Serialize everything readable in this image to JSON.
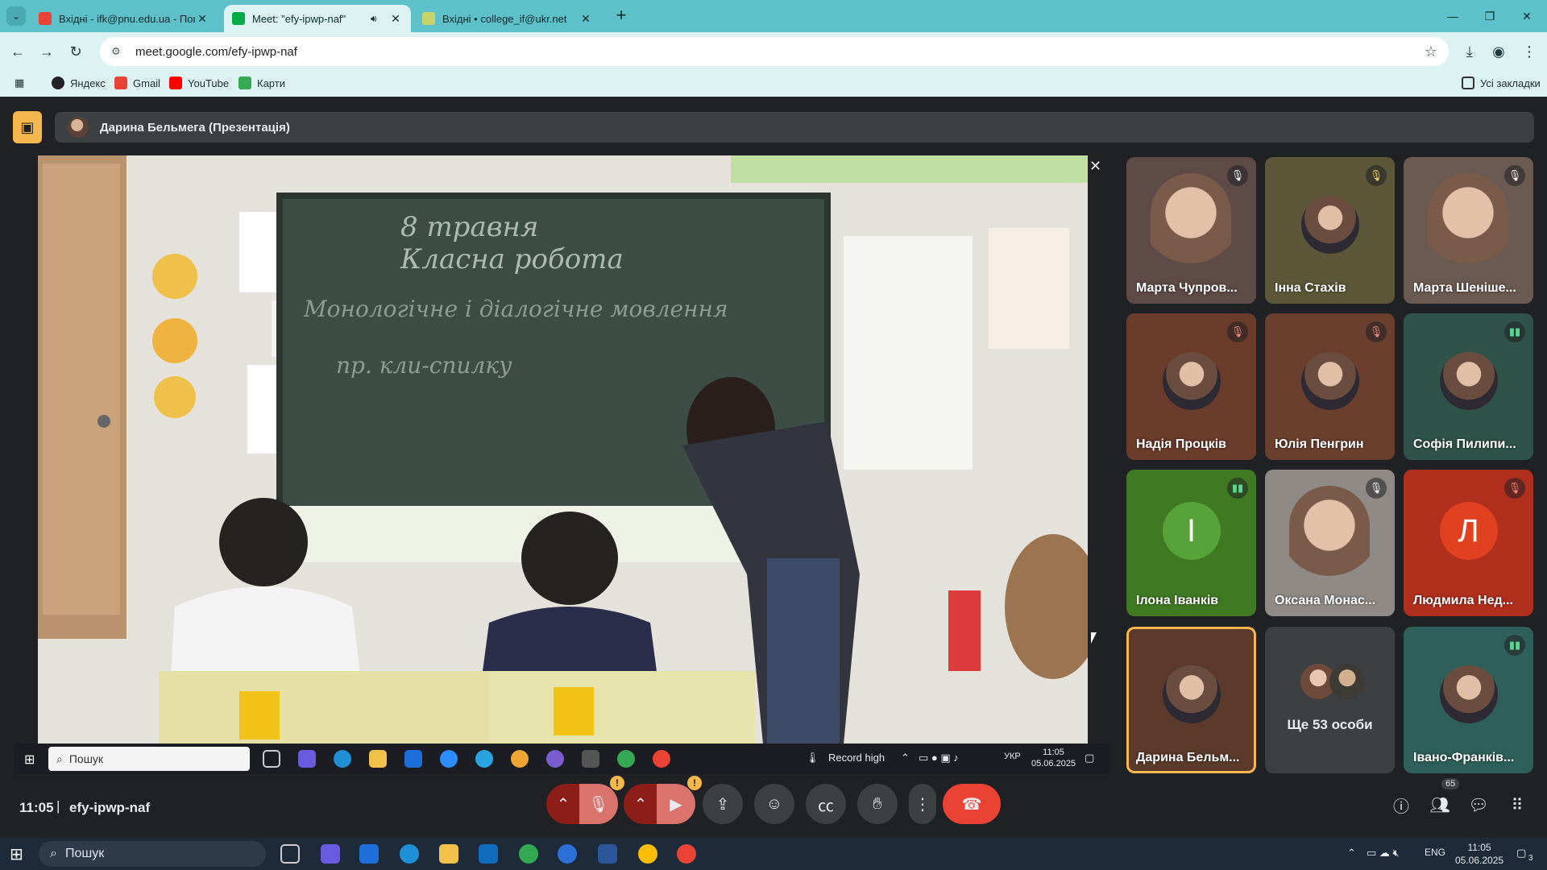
{
  "browser": {
    "tabs": [
      {
        "title": "Вхідні - ifk@pnu.edu.ua - Пош",
        "favicon_color": "#ea4335"
      },
      {
        "title": "Meet: \"efy-ipwp-naf\"",
        "favicon_color": "#00ac47"
      },
      {
        "title": "Вхідні • college_if@ukr.net",
        "favicon_color": "#c9d36b"
      }
    ],
    "url": "meet.google.com/efy-ipwp-naf",
    "bookmarks": [
      "Яндекс",
      "Gmail",
      "YouTube",
      "Карти"
    ],
    "bookmarks_all": "Усі закладки"
  },
  "meet": {
    "presenter_label": "Дарина Бельмега (Презентація)",
    "time": "11:05",
    "separator": "|",
    "code": "efy-ipwp-naf",
    "participants_count": "65",
    "more_label": "Ще 53 особи",
    "accent": "#f6b74f",
    "hangup_color": "#ea4335",
    "tiles": [
      {
        "name": "Марта Чупров...",
        "mic": "muted",
        "bg": "#5e4b47"
      },
      {
        "name": "Інна Стахів",
        "mic": "muted-yellow",
        "bg": "#5c5738"
      },
      {
        "name": "Марта Шеніше...",
        "mic": "muted",
        "bg": "#6b5a52"
      },
      {
        "name": "Надія Процків",
        "mic": "muted-red",
        "bg": "#6b3b2b"
      },
      {
        "name": "Юлія Пенгрин",
        "mic": "muted-red",
        "bg": "#6a3f2e"
      },
      {
        "name": "Софія Пилипи...",
        "mic": "active",
        "bg": "#2f5348"
      },
      {
        "name": "Ілона Іванків",
        "mic": "active",
        "letter": "І",
        "bg": "#3f7a22",
        "letter_bg": "#56a33a"
      },
      {
        "name": "Оксана Монас...",
        "mic": "muted",
        "bg": "#8f8a86"
      },
      {
        "name": "Людмила Нед...",
        "mic": "muted-red",
        "letter": "Л",
        "bg": "#b12f1d",
        "letter_bg": "#e1411f"
      },
      {
        "name": "Дарина Бельм...",
        "mic": "none",
        "bg": "#5b3a2b"
      },
      {
        "name": "Івано-Франків...",
        "mic": "active",
        "bg": "#2e5f5a"
      }
    ]
  },
  "presenter_screen": {
    "search_placeholder": "Пошук",
    "record_label": "Record high",
    "lang": "УКР",
    "clock_time": "11:05",
    "clock_date": "05.06.2025"
  },
  "taskbar": {
    "search_placeholder": "Пошук",
    "lang": "ENG",
    "clock_time": "11:05",
    "clock_date": "05.06.2025",
    "notifications": "3"
  }
}
